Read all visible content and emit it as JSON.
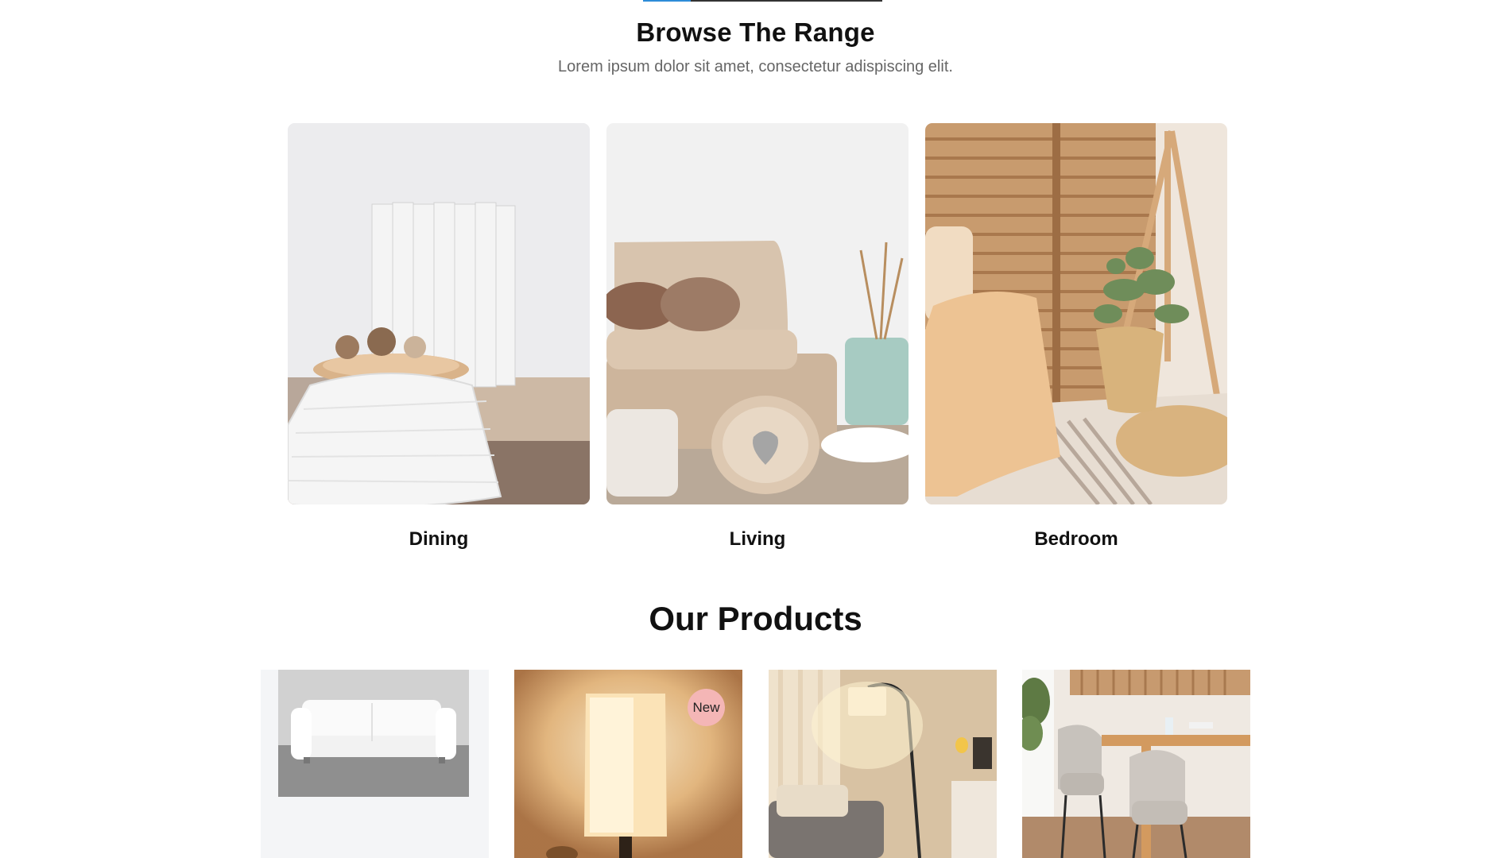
{
  "range": {
    "title": "Browse The Range",
    "subtitle": "Lorem ipsum dolor sit amet, consectetur adispiscing elit.",
    "categories": [
      {
        "label": "Dining"
      },
      {
        "label": "Living"
      },
      {
        "label": "Bedroom"
      }
    ]
  },
  "products": {
    "title": "Our Products",
    "items": [
      {
        "image": "white-sofa"
      },
      {
        "image": "table-lamp",
        "badge": "New"
      },
      {
        "image": "floor-lamp"
      },
      {
        "image": "dining-chairs"
      }
    ]
  },
  "colors": {
    "accent": "#2d8cd8",
    "badge_new": "#f4b6b6",
    "subtitle_text": "#666666"
  }
}
